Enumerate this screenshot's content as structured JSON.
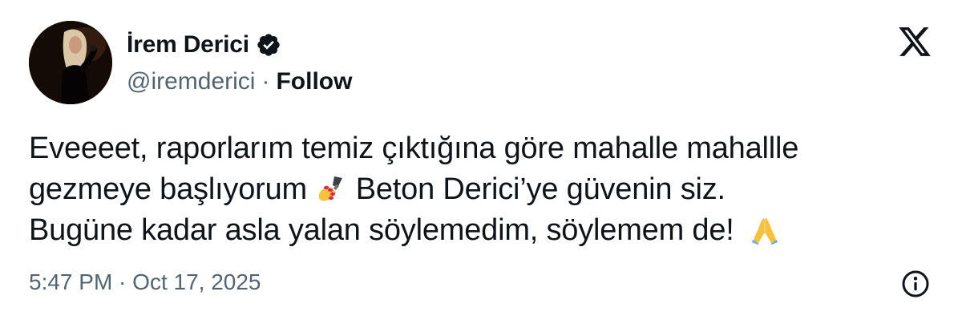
{
  "author": {
    "display_name": "İrem Derici",
    "handle": "@iremderici",
    "separator": "·",
    "follow_label": "Follow",
    "verified": true
  },
  "tweet": {
    "lines": [
      "Eveeeet, raporlarım temiz çıktığına göre mahalle mahallle",
      "gezmeye başlıyorum",
      "Beton Derici’ye güvenin siz.",
      "Bugüne kadar asla yalan söylemedim, söylemem de!"
    ],
    "emojis": [
      "nail-polish-emoji",
      "folded-hands-emoji"
    ]
  },
  "meta": {
    "timestamp": "5:47 PM · Oct 17, 2025"
  },
  "icons": {
    "brand": "x-logo-icon",
    "verified": "verified-badge-icon",
    "info": "info-icon"
  },
  "colors": {
    "text": "#0f1419",
    "secondary": "#536471",
    "background": "#ffffff"
  }
}
